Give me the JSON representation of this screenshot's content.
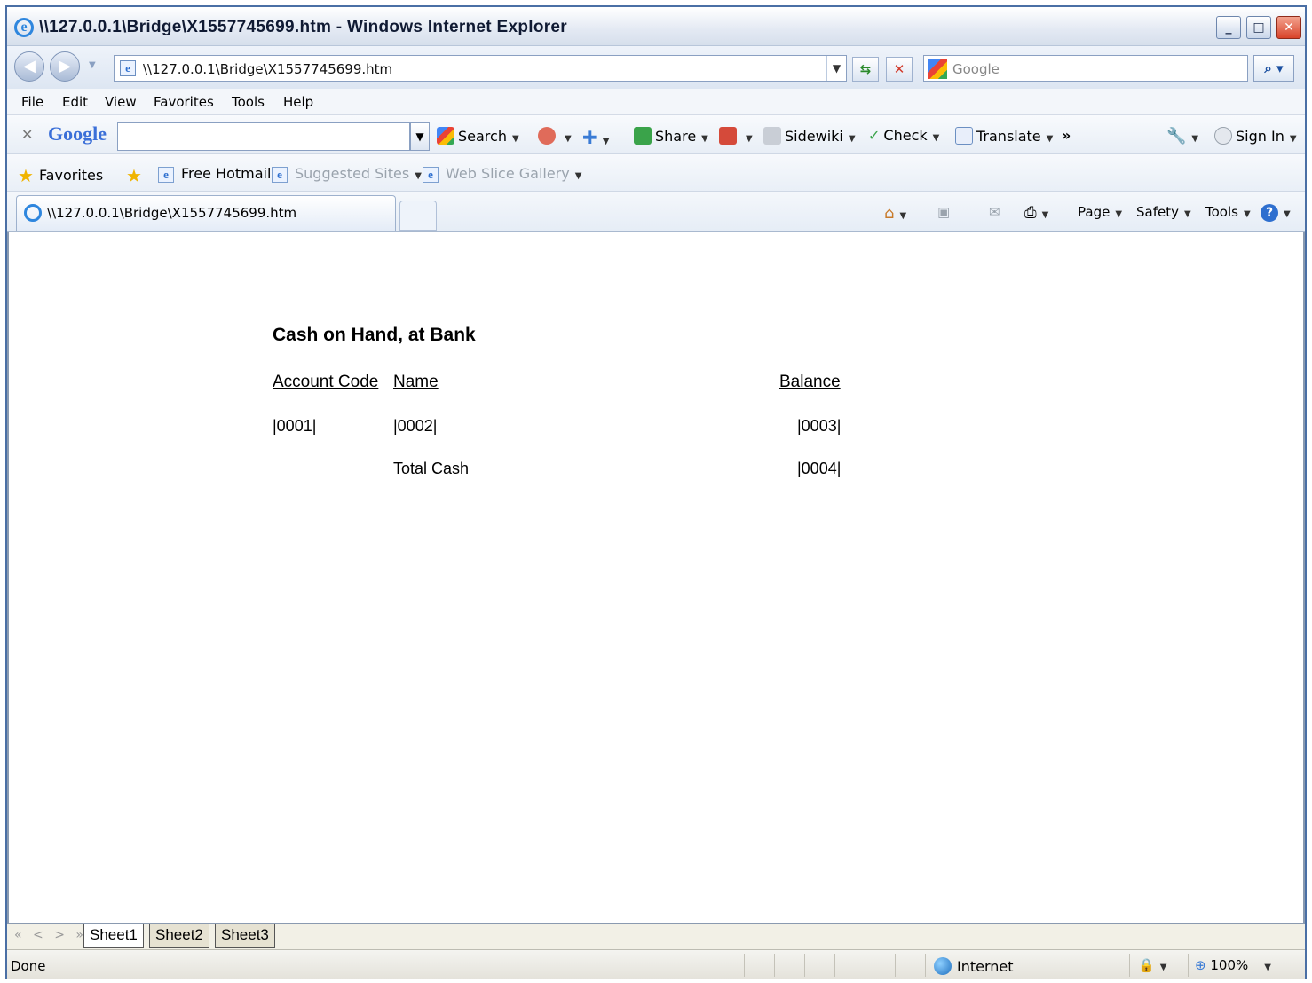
{
  "window": {
    "title": "\\\\127.0.0.1\\Bridge\\X1557745699.htm - Windows Internet Explorer",
    "controls": {
      "minimize": "_",
      "maximize": "□",
      "close": "✕"
    }
  },
  "address_bar": {
    "url": "\\\\127.0.0.1\\Bridge\\X1557745699.htm",
    "search_placeholder": "Google"
  },
  "menu": [
    "File",
    "Edit",
    "View",
    "Favorites",
    "Tools",
    "Help"
  ],
  "google_toolbar": {
    "logo": "Google",
    "search_label": "Search",
    "share_label": "Share",
    "sidewiki_label": "Sidewiki",
    "check_label": "Check",
    "translate_label": "Translate",
    "more": "»",
    "sign_in_label": "Sign In"
  },
  "favorites_bar": {
    "favorites_label": "Favorites",
    "links": [
      "Free Hotmail",
      "Suggested Sites",
      "Web Slice Gallery"
    ]
  },
  "tab": {
    "title": "\\\\127.0.0.1\\Bridge\\X1557745699.htm"
  },
  "command_bar": {
    "page_label": "Page",
    "safety_label": "Safety",
    "tools_label": "Tools"
  },
  "report": {
    "title": "Cash on Hand, at Bank",
    "headers": {
      "account_code": "Account Code",
      "name": "Name",
      "balance": "Balance"
    },
    "row": {
      "account_code": "|0001|",
      "name": "|0002|",
      "balance": "|0003|"
    },
    "total": {
      "label": "Total Cash",
      "value": "|0004|"
    }
  },
  "sheets": {
    "nav": "« < > »",
    "tabs": [
      "Sheet1",
      "Sheet2",
      "Sheet3"
    ],
    "active": "Sheet1"
  },
  "status_bar": {
    "status": "Done",
    "zone": "Internet",
    "zoom": "100%"
  }
}
